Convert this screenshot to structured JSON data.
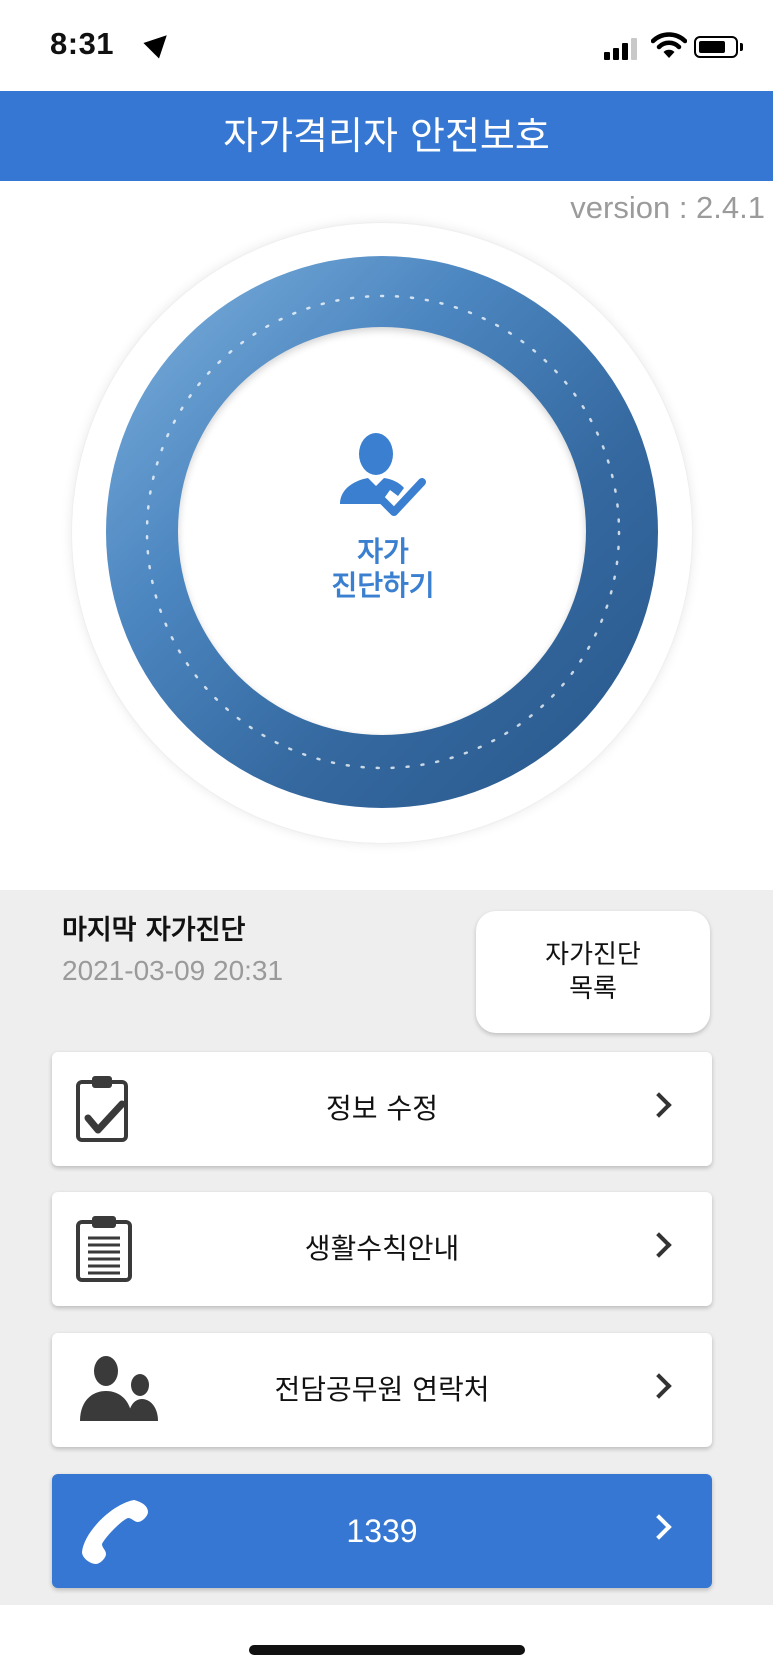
{
  "status_bar": {
    "time": "8:31",
    "icons": [
      "location-arrow-icon",
      "signal-icon",
      "wifi-icon",
      "battery-icon"
    ]
  },
  "header": {
    "title": "자가격리자 안전보호",
    "background": "#3577d2"
  },
  "version": "version : 2.4.1",
  "self_check": {
    "label_line1": "자가",
    "label_line2": "진단하기",
    "icon": "user-check-icon",
    "color": "#3a7fd0"
  },
  "last_check": {
    "label": "마지막 자가진단",
    "datetime": "2021-03-09 20:31"
  },
  "list_button": {
    "label": "자가진단\n목록"
  },
  "menu": [
    {
      "label": "정보 수정",
      "icon": "clipboard-check-icon"
    },
    {
      "label": "생활수칙안내",
      "icon": "clipboard-list-icon"
    },
    {
      "label": "전담공무원 연락처",
      "icon": "people-icon"
    }
  ],
  "call": {
    "label": "1339",
    "icon": "phone-icon"
  }
}
